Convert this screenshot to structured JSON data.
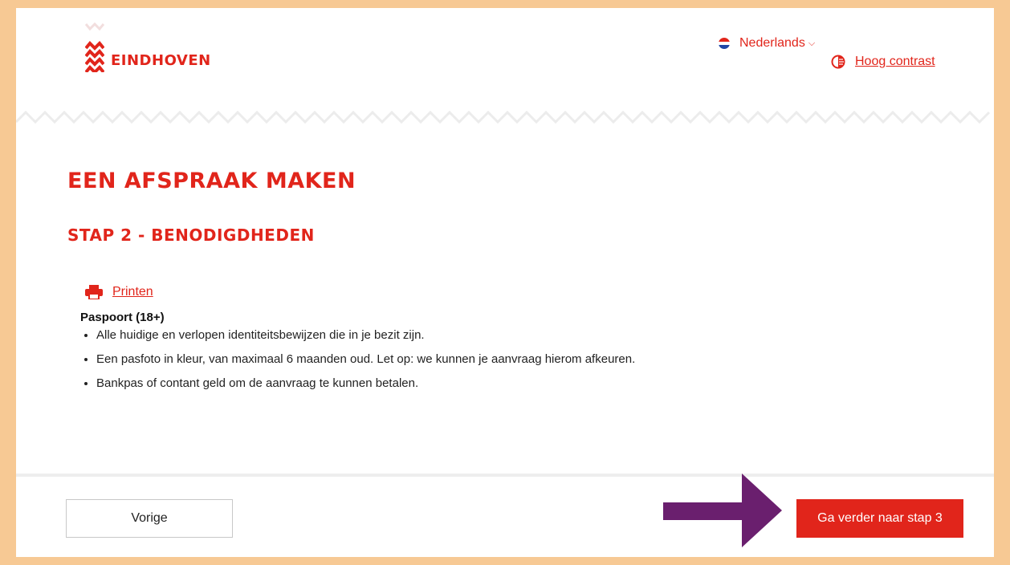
{
  "header": {
    "logo_text": "EINDHOVEN",
    "language_label": "Nederlands",
    "contrast_label": "Hoog contrast"
  },
  "main": {
    "title": "EEN AFSPRAAK MAKEN",
    "step_title": "STAP 2 - BENODIGDHEDEN",
    "print_label": "Printen",
    "document_title": "Paspoort (18+)",
    "requirements": [
      "Alle huidige en verlopen identiteitsbewijzen die in je bezit zijn.",
      "Een pasfoto in kleur, van maximaal 6 maanden oud. Let op: we kunnen je aanvraag hierom afkeuren.",
      "Bankpas of contant geld om de aanvraag te kunnen betalen."
    ]
  },
  "footer": {
    "prev_label": "Vorige",
    "next_label": "Ga verder naar stap 3"
  },
  "colors": {
    "brand_red": "#e1251b",
    "frame": "#f7c994",
    "arrow": "#6a1f6e"
  }
}
